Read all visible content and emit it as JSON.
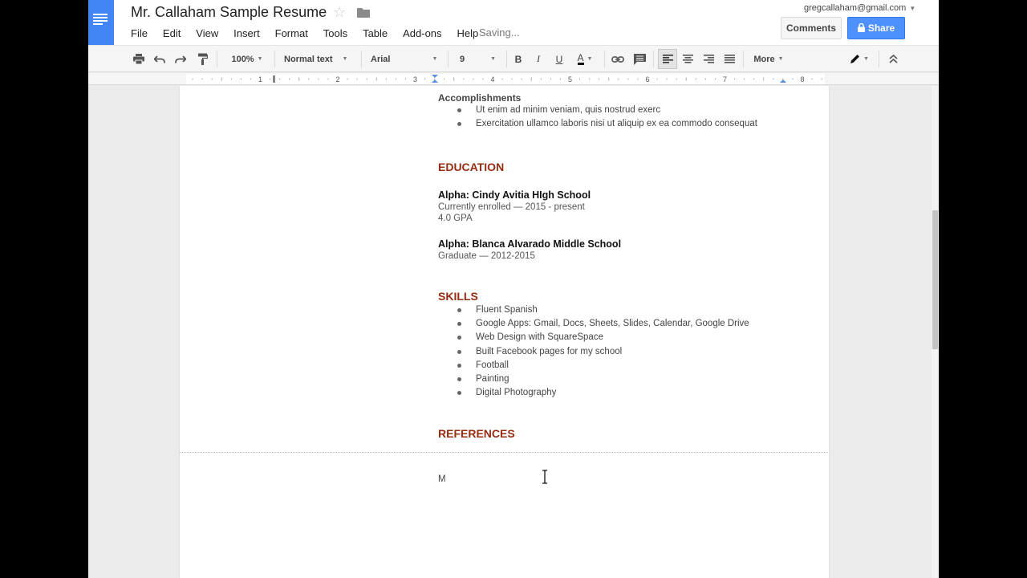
{
  "header": {
    "title": "Mr. Callaham Sample Resume",
    "star_icon": "star-outline-icon",
    "folder_icon": "folder-icon",
    "saving_status": "Saving...",
    "user_email": "gregcallaham@gmail.com",
    "comments_label": "Comments",
    "share_label": "Share"
  },
  "menu": [
    "File",
    "Edit",
    "View",
    "Insert",
    "Format",
    "Tools",
    "Table",
    "Add-ons",
    "Help"
  ],
  "toolbar": {
    "zoom": "100%",
    "style": "Normal text",
    "font": "Arial",
    "size": "9",
    "bold": "B",
    "italic": "I",
    "underline": "U",
    "text_color": "A",
    "more": "More"
  },
  "ruler": {
    "numbers": [
      "1",
      "2",
      "3",
      "4",
      "5",
      "6",
      "7",
      "8"
    ]
  },
  "document": {
    "accomplishments_heading": "Accomplishments",
    "accomplishments": [
      "Ut enim ad minim veniam, quis nostrud exerc",
      "Exercitation ullamco laboris nisi ut aliquip ex ea commodo consequat"
    ],
    "education_heading": "EDUCATION",
    "schools": [
      {
        "name": "Alpha: Cindy Avitia HIgh School",
        "details": [
          "Currently enrolled — 2015 - present",
          "4.0 GPA"
        ]
      },
      {
        "name": "Alpha: Blanca Alvarado Middle School",
        "details": [
          "Graduate — 2012-2015"
        ]
      }
    ],
    "skills_heading": "SKILLS",
    "skills": [
      "Fluent Spanish",
      "Google Apps: Gmail, Docs, Sheets, Slides, Calendar, Google Drive",
      "Web Design with SquareSpace",
      "Built Facebook pages for my school",
      "Football",
      "Painting",
      "Digital Photography"
    ],
    "references_heading": "REFERENCES",
    "page2_text": "M"
  },
  "colors": {
    "accent_blue": "#4285f4",
    "share_blue": "#4d90fe",
    "heading_red": "#972c12"
  }
}
